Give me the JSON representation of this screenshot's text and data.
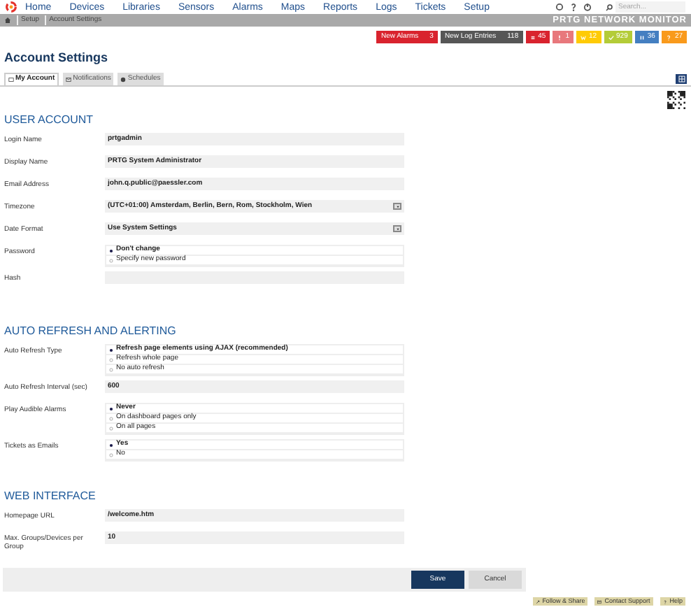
{
  "nav": {
    "items": [
      "Home",
      "Devices",
      "Libraries",
      "Sensors",
      "Alarms",
      "Maps",
      "Reports",
      "Logs",
      "Tickets",
      "Setup"
    ],
    "search": {
      "placeholder": "Search..."
    }
  },
  "breadcrumb": [
    "Setup",
    "Account Settings"
  ],
  "brand": "PRTG NETWORK MONITOR",
  "status_badges": [
    {
      "label": "New Alarms",
      "count": "3",
      "color": "#d9232e"
    },
    {
      "label": "New Log Entries",
      "count": "118",
      "color": "#565656"
    }
  ],
  "sensor_counts": [
    {
      "kind": "down",
      "count": "45",
      "color": "#d9232e"
    },
    {
      "kind": "partial",
      "count": "1",
      "color": "#e8787c"
    },
    {
      "kind": "warning",
      "count": "12",
      "color": "#ffcb05"
    },
    {
      "kind": "up",
      "count": "929",
      "color": "#b4cc38"
    },
    {
      "kind": "paused",
      "count": "36",
      "color": "#447fc1"
    },
    {
      "kind": "unknown",
      "count": "27",
      "color": "#f99a1c"
    }
  ],
  "title": "Account Settings",
  "tabs": [
    {
      "label": "My Account",
      "selected": true
    },
    {
      "label": "Notifications",
      "selected": false
    },
    {
      "label": "Schedules",
      "selected": false
    }
  ],
  "sections": [
    {
      "heading": "USER ACCOUNT",
      "fields": [
        {
          "kind": "text",
          "label": "Login Name",
          "value": "prtgadmin"
        },
        {
          "kind": "text",
          "label": "Display Name",
          "value": "PRTG System Administrator"
        },
        {
          "kind": "text",
          "label": "Email Address",
          "value": "john.q.public@paessler.com"
        },
        {
          "kind": "select",
          "label": "Timezone",
          "value": "(UTC+01:00) Amsterdam, Berlin, Bern, Rom, Stockholm, Wien"
        },
        {
          "kind": "select",
          "label": "Date Format",
          "value": "Use System Settings"
        },
        {
          "kind": "radio",
          "label": "Password",
          "options": [
            {
              "label": "Don't change",
              "selected": true
            },
            {
              "label": "Specify new password",
              "selected": false
            }
          ]
        },
        {
          "kind": "text",
          "label": "Hash"
        }
      ]
    },
    {
      "heading": "AUTO REFRESH AND ALERTING",
      "fields": [
        {
          "kind": "radio",
          "label": "Auto Refresh Type",
          "options": [
            {
              "label": "Refresh page elements using AJAX (recommended)",
              "selected": true
            },
            {
              "label": "Refresh whole page",
              "selected": false
            },
            {
              "label": "No auto refresh",
              "selected": false
            }
          ]
        },
        {
          "kind": "text",
          "label": "Auto Refresh Interval (sec)",
          "value": "600"
        },
        {
          "kind": "radio",
          "label": "Play Audible Alarms",
          "options": [
            {
              "label": "Never",
              "selected": true
            },
            {
              "label": "On dashboard pages only",
              "selected": false
            },
            {
              "label": "On all pages",
              "selected": false
            }
          ]
        },
        {
          "kind": "radio",
          "label": "Tickets as Emails",
          "options": [
            {
              "label": "Yes",
              "selected": true
            },
            {
              "label": "No",
              "selected": false
            }
          ]
        }
      ]
    },
    {
      "heading": "WEB INTERFACE",
      "fields": [
        {
          "kind": "text",
          "label": "Homepage URL",
          "value": "/welcome.htm"
        },
        {
          "kind": "text",
          "label": "Max. Groups/Devices per Group",
          "value": "10"
        }
      ]
    }
  ],
  "buttons": [
    {
      "label": "Save",
      "kind": "primary"
    },
    {
      "label": "Cancel",
      "kind": "secondary"
    }
  ],
  "footer_links": [
    {
      "label": "Follow & Share",
      "kind": "share"
    },
    {
      "label": "Contact Support",
      "kind": "mail"
    },
    {
      "label": "Help",
      "kind": "help"
    }
  ]
}
